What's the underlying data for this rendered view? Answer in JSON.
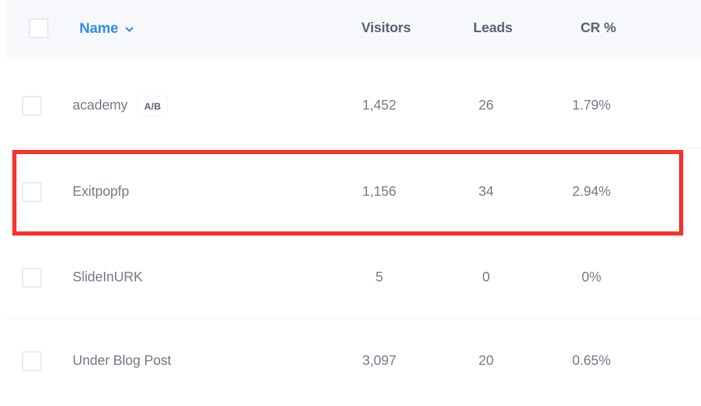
{
  "table": {
    "header": {
      "select_all_checkbox": "unchecked",
      "columns": [
        {
          "label": "Name",
          "sorted": true,
          "sort_icon": "chevron-down-icon"
        },
        {
          "label": "Visitors",
          "sorted": false
        },
        {
          "label": "Leads",
          "sorted": false
        },
        {
          "label": "CR %",
          "sorted": false
        }
      ]
    },
    "rows": [
      {
        "name": "academy",
        "badge": "A/B",
        "visitors": "1,452",
        "leads": "26",
        "cr": "1.79%",
        "highlighted": false
      },
      {
        "name": "Exitpopfp",
        "badge": "",
        "visitors": "1,156",
        "leads": "34",
        "cr": "2.94%",
        "highlighted": true
      },
      {
        "name": "SlideInURK",
        "badge": "",
        "visitors": "5",
        "leads": "0",
        "cr": "0%",
        "highlighted": false
      },
      {
        "name": "Under Blog Post",
        "badge": "",
        "visitors": "3,097",
        "leads": "20",
        "cr": "0.65%",
        "highlighted": false
      }
    ]
  },
  "annotation": {
    "type": "highlight-rectangle",
    "color": "#f8322a",
    "target_row": "Exitpopfp"
  },
  "colors": {
    "header_background": "#f7f8fc",
    "sorted_column": "#2f8de4",
    "header_text": "#5b6170",
    "cell_text": "#737a89",
    "divider": "#eceef4",
    "checkbox_border": "#e7e9ef",
    "annotation": "#f8322a"
  }
}
